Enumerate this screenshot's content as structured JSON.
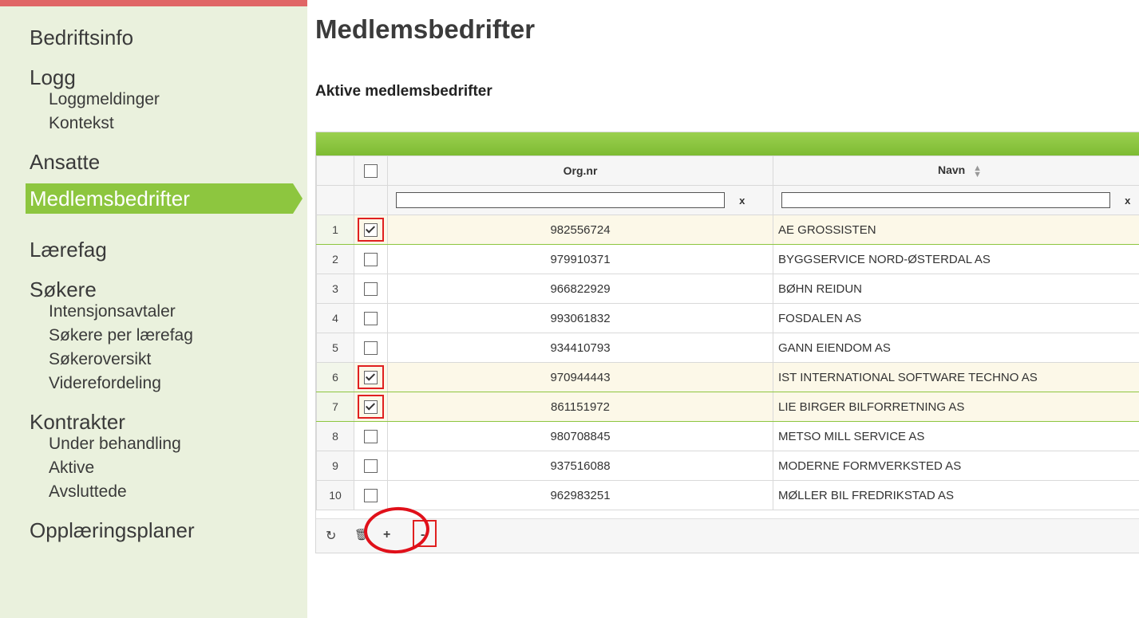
{
  "sidebar": {
    "sections": [
      {
        "label": "Bedriftsinfo",
        "items": []
      },
      {
        "label": "Logg",
        "items": [
          "Loggmeldinger",
          "Kontekst"
        ]
      },
      {
        "label": "Ansatte",
        "items": []
      },
      {
        "label": "Medlemsbedrifter",
        "items": [],
        "active": true
      },
      {
        "label": "Lærefag",
        "items": []
      },
      {
        "label": "Søkere",
        "items": [
          "Intensjonsavtaler",
          "Søkere per lærefag",
          "Søkeroversikt",
          "Viderefordeling"
        ]
      },
      {
        "label": "Kontrakter",
        "items": [
          "Under behandling",
          "Aktive",
          "Avsluttede"
        ]
      },
      {
        "label": "Opplæringsplaner",
        "items": []
      }
    ]
  },
  "main": {
    "title": "Medlemsbedrifter",
    "subtitle": "Aktive medlemsbedrifter"
  },
  "grid": {
    "columns": {
      "org": "Org.nr",
      "name": "Navn"
    },
    "filter_clear": "x",
    "rows": [
      {
        "n": "1",
        "org": "982556724",
        "name": "AE GROSSISTEN",
        "checked": true
      },
      {
        "n": "2",
        "org": "979910371",
        "name": "BYGGSERVICE NORD-ØSTERDAL AS",
        "checked": false
      },
      {
        "n": "3",
        "org": "966822929",
        "name": "BØHN REIDUN",
        "checked": false
      },
      {
        "n": "4",
        "org": "993061832",
        "name": "FOSDALEN AS",
        "checked": false
      },
      {
        "n": "5",
        "org": "934410793",
        "name": "GANN EIENDOM AS",
        "checked": false
      },
      {
        "n": "6",
        "org": "970944443",
        "name": "IST INTERNATIONAL SOFTWARE TECHNO AS",
        "checked": true
      },
      {
        "n": "7",
        "org": "861151972",
        "name": "LIE BIRGER BILFORRETNING AS",
        "checked": true
      },
      {
        "n": "8",
        "org": "980708845",
        "name": "METSO MILL SERVICE AS",
        "checked": false
      },
      {
        "n": "9",
        "org": "937516088",
        "name": "MODERNE FORMVERKSTED AS",
        "checked": false
      },
      {
        "n": "10",
        "org": "962983251",
        "name": "MØLLER BIL FREDRIKSTAD AS",
        "checked": false
      }
    ],
    "pager": {
      "refresh": "↻",
      "delete": "🗑",
      "add": "+",
      "remove": "-"
    }
  },
  "colors": {
    "accent": "#8dc63f",
    "sidebar_bg": "#eaf1dd",
    "highlight": "#e02020"
  }
}
